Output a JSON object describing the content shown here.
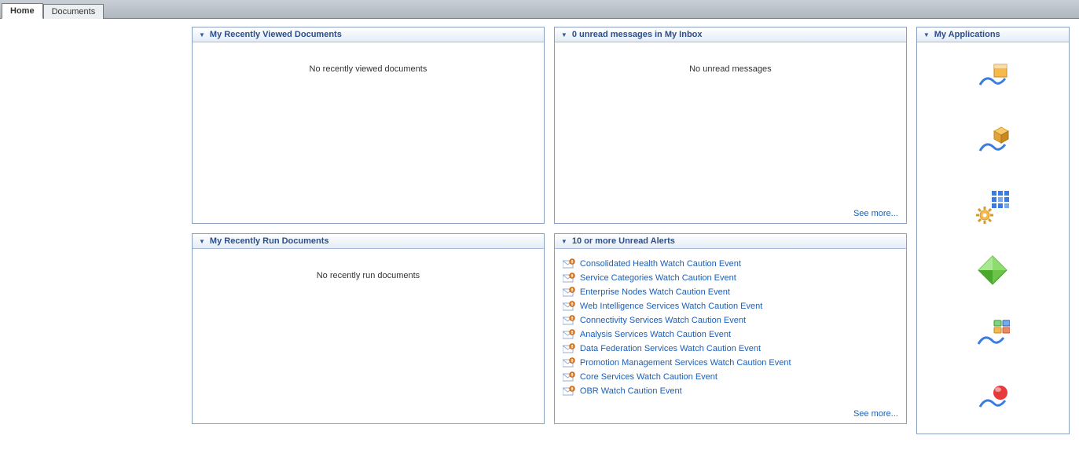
{
  "tabs": {
    "home": "Home",
    "documents": "Documents"
  },
  "panels": {
    "recentViewed": {
      "title": "My Recently Viewed Documents",
      "empty": "No recently viewed documents"
    },
    "inbox": {
      "title": "0 unread messages in My Inbox",
      "empty": "No unread messages",
      "seeMore": "See more..."
    },
    "recentRun": {
      "title": "My Recently Run Documents",
      "empty": "No recently run documents"
    },
    "alerts": {
      "title": "10 or more Unread Alerts",
      "seeMore": "See more...",
      "items": [
        "Consolidated Health Watch Caution Event",
        "Service Categories Watch Caution Event",
        "Enterprise Nodes Watch Caution Event",
        "Web Intelligence Services Watch Caution Event",
        "Connectivity Services Watch Caution Event",
        "Analysis Services Watch Caution Event",
        "Data Federation Services Watch Caution Event",
        "Promotion Management Services Watch Caution Event",
        "Core Services Watch Caution Event",
        "OBR Watch Caution Event"
      ]
    },
    "apps": {
      "title": "My Applications"
    }
  }
}
